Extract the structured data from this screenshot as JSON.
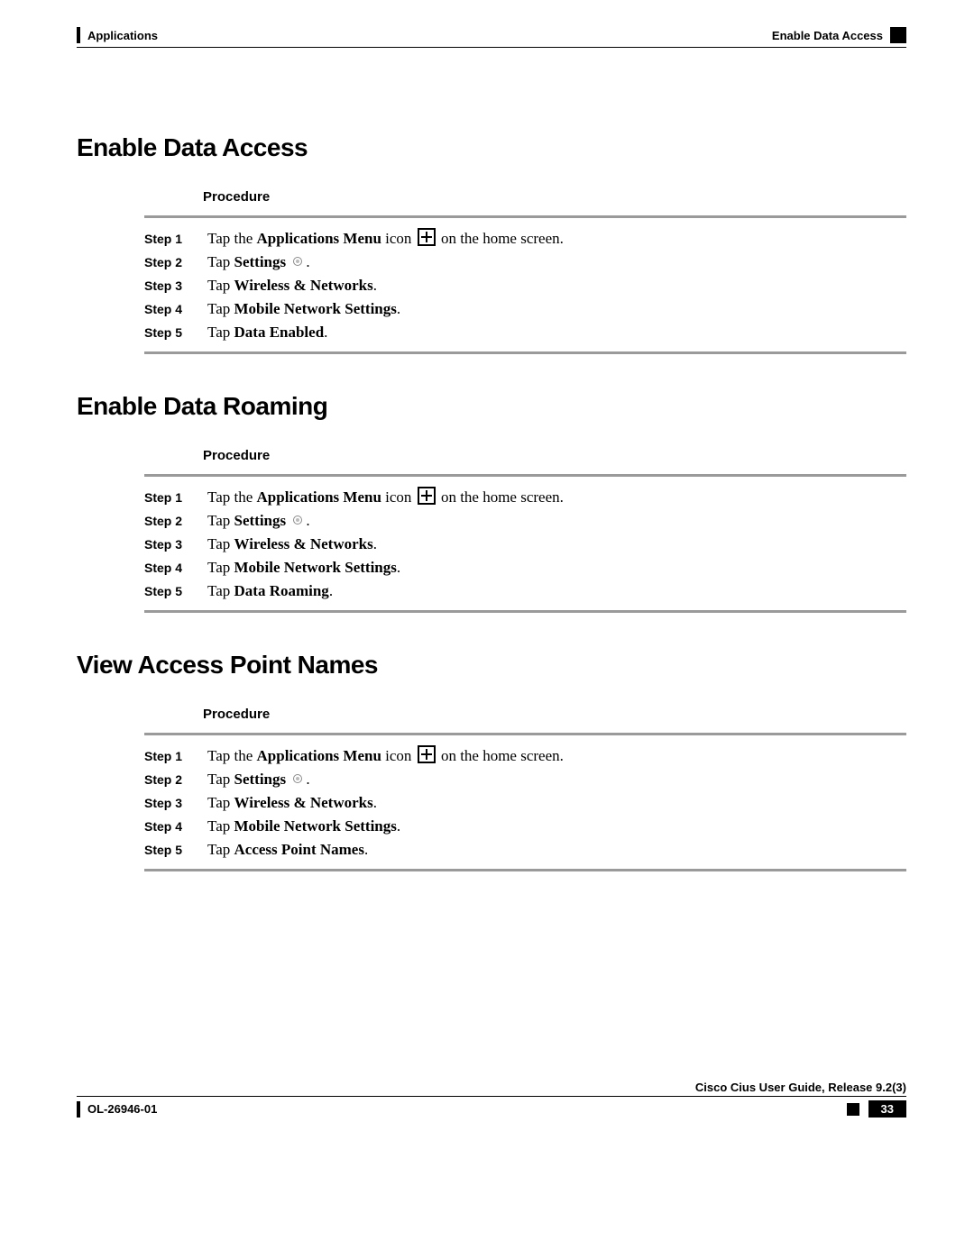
{
  "header": {
    "chapter": "Applications",
    "section": "Enable Data Access"
  },
  "sections": [
    {
      "title": "Enable Data Access",
      "procedure_label": "Procedure",
      "steps": [
        {
          "label": "Step 1",
          "pre": "Tap the ",
          "bold": "Applications Menu",
          "mid": " icon ",
          "icon": "apps",
          "post": " on the home screen."
        },
        {
          "label": "Step 2",
          "pre": "Tap ",
          "bold": "Settings",
          "mid": " ",
          "icon": "gear",
          "post": "."
        },
        {
          "label": "Step 3",
          "pre": "Tap ",
          "bold": "Wireless & Networks",
          "post": "."
        },
        {
          "label": "Step 4",
          "pre": "Tap ",
          "bold": "Mobile Network Settings",
          "post": "."
        },
        {
          "label": "Step 5",
          "pre": "Tap ",
          "bold": "Data Enabled",
          "post": "."
        }
      ]
    },
    {
      "title": "Enable Data Roaming",
      "procedure_label": "Procedure",
      "steps": [
        {
          "label": "Step 1",
          "pre": "Tap the ",
          "bold": "Applications Menu",
          "mid": " icon ",
          "icon": "apps",
          "post": " on the home screen."
        },
        {
          "label": "Step 2",
          "pre": "Tap ",
          "bold": "Settings",
          "mid": " ",
          "icon": "gear",
          "post": "."
        },
        {
          "label": "Step 3",
          "pre": "Tap ",
          "bold": "Wireless & Networks",
          "post": "."
        },
        {
          "label": "Step 4",
          "pre": "Tap ",
          "bold": "Mobile Network Settings",
          "post": "."
        },
        {
          "label": "Step 5",
          "pre": "Tap ",
          "bold": "Data Roaming",
          "post": "."
        }
      ]
    },
    {
      "title": "View Access Point Names",
      "procedure_label": "Procedure",
      "steps": [
        {
          "label": "Step 1",
          "pre": "Tap the ",
          "bold": "Applications Menu",
          "mid": " icon ",
          "icon": "apps",
          "post": " on the home screen."
        },
        {
          "label": "Step 2",
          "pre": "Tap ",
          "bold": "Settings",
          "mid": " ",
          "icon": "gear",
          "post": "."
        },
        {
          "label": "Step 3",
          "pre": "Tap ",
          "bold": "Wireless & Networks",
          "post": "."
        },
        {
          "label": "Step 4",
          "pre": "Tap ",
          "bold": "Mobile Network Settings",
          "post": "."
        },
        {
          "label": "Step 5",
          "pre": "Tap ",
          "bold": "Access Point Names",
          "post": "."
        }
      ]
    }
  ],
  "footer": {
    "guide": "Cisco Cius User Guide, Release 9.2(3)",
    "docid": "OL-26946-01",
    "page": "33"
  }
}
